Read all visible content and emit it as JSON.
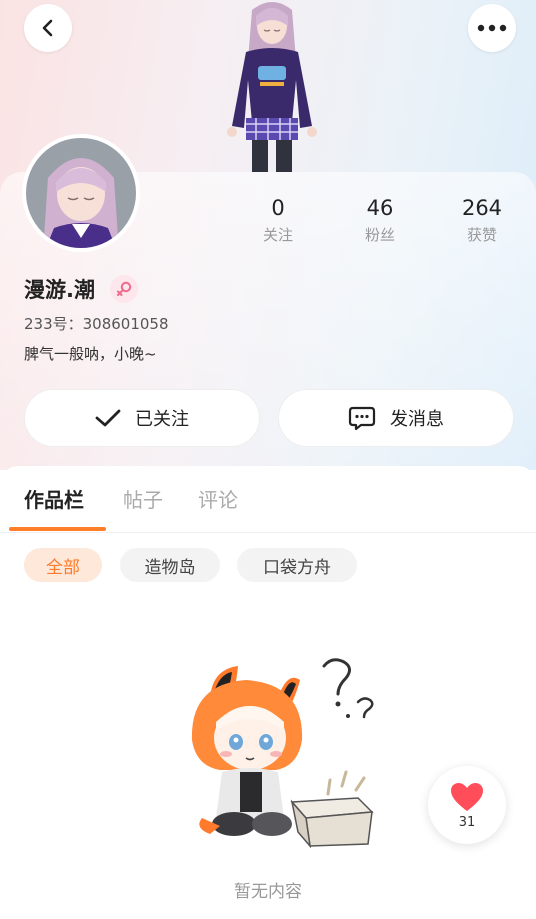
{
  "profile": {
    "username": "漫游.潮",
    "uid_text": "233号：308601058",
    "bio": "脾气一般呐，小晚~"
  },
  "stats": [
    {
      "value": "0",
      "label": "关注"
    },
    {
      "value": "46",
      "label": "粉丝"
    },
    {
      "value": "264",
      "label": "获赞"
    }
  ],
  "actions": {
    "follow_label": "已关注",
    "message_label": "发消息"
  },
  "tabs": [
    {
      "label": "作品栏",
      "active": true
    },
    {
      "label": "帖子",
      "active": false
    },
    {
      "label": "评论",
      "active": false
    }
  ],
  "filters": [
    {
      "label": "全部",
      "active": true
    },
    {
      "label": "造物岛",
      "active": false
    },
    {
      "label": "口袋方舟",
      "active": false
    }
  ],
  "empty_state": {
    "text": "暂无内容"
  },
  "like": {
    "count": "31"
  },
  "colors": {
    "accent": "#ff7e2a",
    "heart": "#ff4d5a",
    "gender": "#ee6b8c"
  }
}
